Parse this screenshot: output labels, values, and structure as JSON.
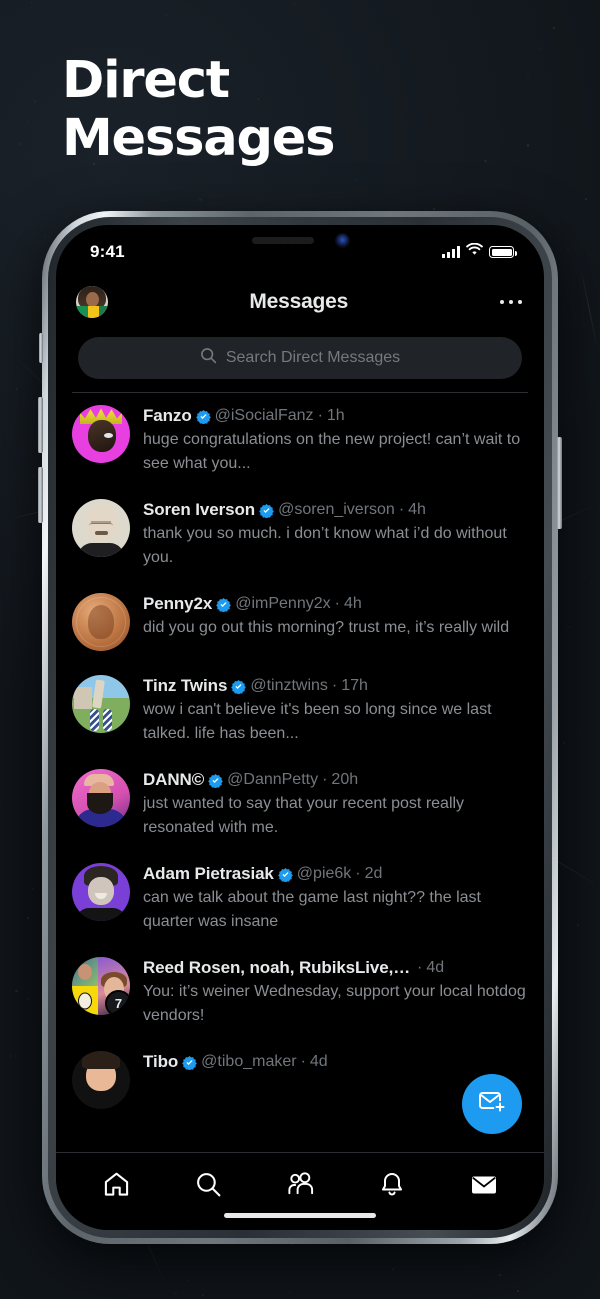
{
  "poster": {
    "title_line1": "Direct",
    "title_line2": "Messages"
  },
  "statusbar": {
    "time": "9:41",
    "signal_icon": "cellular-signal-icon",
    "wifi_icon": "wifi-icon",
    "battery_icon": "battery-icon"
  },
  "header": {
    "avatar_name": "profile-avatar",
    "title": "Messages",
    "more_icon": "more-options-icon"
  },
  "search": {
    "icon": "search-icon",
    "placeholder": "Search Direct Messages",
    "value": ""
  },
  "conversations": [
    {
      "name": "Fanzo",
      "verified": true,
      "handle": "@iSocialFanz",
      "separator": "·",
      "time": "1h",
      "preview": "huge congratulations on the new project! can’t wait to see what you...",
      "avatar": "fanzo-avatar"
    },
    {
      "name": "Soren Iverson",
      "verified": true,
      "handle": "@soren_iverson",
      "separator": "·",
      "time": "4h",
      "preview": "thank you so much. i don’t know what i’d do without you.",
      "avatar": "soren-iverson-avatar"
    },
    {
      "name": "Penny2x",
      "verified": true,
      "handle": "@imPenny2x",
      "separator": "·",
      "time": "4h",
      "preview": "did you go out this morning? trust me, it’s really wild",
      "avatar": "penny2x-avatar"
    },
    {
      "name": "Tinz Twins",
      "verified": true,
      "handle": "@tinztwins",
      "separator": "·",
      "time": "17h",
      "preview": "wow i can't believe it's been so long since we last talked. life has been...",
      "avatar": "tinz-twins-avatar"
    },
    {
      "name": "DANN©",
      "verified": true,
      "handle": "@DannPetty",
      "separator": "·",
      "time": "20h",
      "preview": "just wanted to say that your recent post really resonated with me.",
      "avatar": "dann-avatar"
    },
    {
      "name": "Adam Pietrasiak",
      "verified": true,
      "handle": "@pie6k",
      "separator": "·",
      "time": "2d",
      "preview": "can we talk about the game last night?? the last quarter was insane",
      "avatar": "adam-pietrasiak-avatar"
    },
    {
      "name": "Reed Rosen, noah, RubiksLive, H...",
      "verified": false,
      "handle": "",
      "separator": "·",
      "time": "4d",
      "preview": "You: it’s weiner Wednesday, support your local hotdog vendors!",
      "avatar": "group-avatar",
      "group_count": "7"
    },
    {
      "name": "Tibo",
      "verified": true,
      "handle": "@tibo_maker",
      "separator": "·",
      "time": "4d",
      "preview": "",
      "avatar": "tibo-avatar"
    }
  ],
  "fab": {
    "icon": "new-message-icon",
    "color": "#1D9BF0"
  },
  "navbar": [
    {
      "icon": "home-icon",
      "active": false
    },
    {
      "icon": "search-icon",
      "active": false
    },
    {
      "icon": "communities-icon",
      "active": false
    },
    {
      "icon": "notifications-bell-icon",
      "active": false
    },
    {
      "icon": "messages-envelope-icon",
      "active": true
    }
  ],
  "colors": {
    "accent": "#1D9BF0",
    "verified_badge": "#1D9BF0",
    "text_primary": "#E7E9EA",
    "text_secondary": "#71767B",
    "screen_bg": "#000000",
    "poster_bg": "#10151A"
  }
}
